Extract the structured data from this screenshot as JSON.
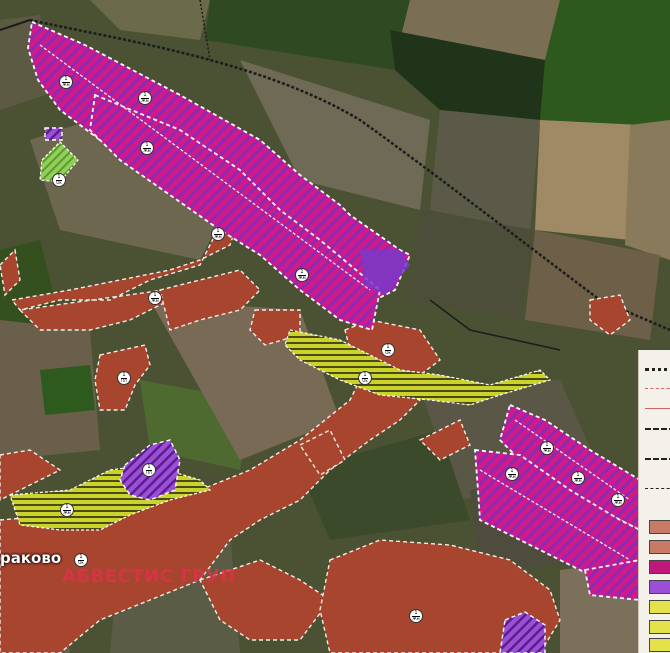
{
  "map": {
    "village_label": "раково",
    "watermark": "АБВЕСТИС ГРУП",
    "zone_markers": [
      {
        "code": "Жм"
      },
      {
        "code": "Жм"
      },
      {
        "code": "Жм"
      },
      {
        "code": "Ок"
      },
      {
        "code": "Жм"
      },
      {
        "code": "Жм"
      },
      {
        "code": "Жм"
      },
      {
        "code": "Ок"
      },
      {
        "code": "Пп"
      },
      {
        "code": "Ок"
      },
      {
        "code": "Жм"
      },
      {
        "code": "Жм"
      },
      {
        "code": "Жм"
      },
      {
        "code": "Жм"
      },
      {
        "code": "Жм"
      },
      {
        "code": "Ок"
      },
      {
        "code": "Жм"
      },
      {
        "code": "Пп"
      }
    ]
  },
  "colors": {
    "residential": "#a8452f",
    "production_stripes": "#c2177a",
    "industrial": "#8a3fc0",
    "greenery": "#c9d32a",
    "field_dark": "#3e4a2c",
    "road": "#1c1c1c"
  }
}
